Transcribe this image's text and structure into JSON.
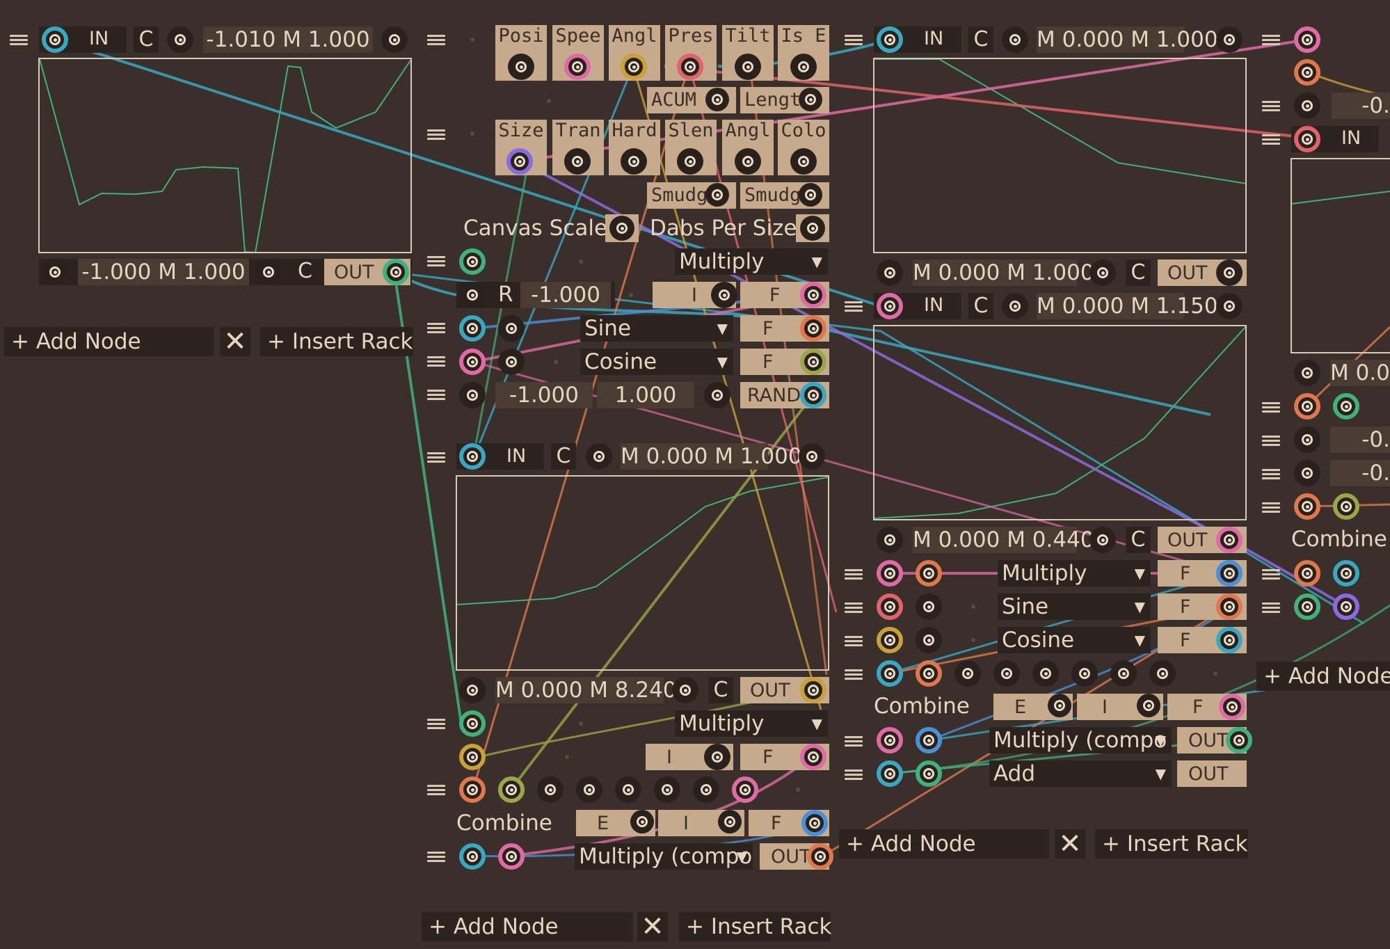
{
  "colors": {
    "background": "#3a2f2a",
    "teal": "#3aa7c2",
    "pink": "#e06aa6",
    "orange": "#e0774f",
    "green": "#41b07a",
    "olive": "#9aa64a",
    "purple": "#8a6ae0",
    "yellow": "#c9a03a",
    "red": "#e0626b",
    "blue": "#4a90d9",
    "tan": "#c7a98c"
  },
  "rack1": {
    "in_label": "IN",
    "c_label": "C",
    "in_range": "-1.010 M 1.000",
    "out_range": "-1.000 M 1.000",
    "out_c_label": "C",
    "out_label": "OUT",
    "add_node": "Add Node",
    "insert_rack": "Insert Rack"
  },
  "rack2": {
    "tabs1": [
      "Posi",
      "Spee",
      "Angl",
      "Pres",
      "Tilt",
      "Is E"
    ],
    "acum": "ACUM",
    "lengt": "Lengt",
    "tabs2": [
      "Size",
      "Tran",
      "Hard",
      "Slen",
      "Angl",
      "Colo"
    ],
    "smudg1": "Smudg",
    "smudg2": "Smudg",
    "canvas_scale": "Canvas Scale",
    "dabs_per_size": "Dabs Per Size",
    "multiply": "Multiply",
    "r_label": "R",
    "r_value": "-1.000",
    "i_label": "I",
    "f_label": "F",
    "sine": "Sine",
    "cosine": "Cosine",
    "rand_min": "-1.000",
    "rand_max": "1.000",
    "rand": "RAND",
    "in_label": "IN",
    "c_label": "C",
    "in_range": "M 0.000 M 1.000",
    "out_range": "M 0.000 M 8.240",
    "out_c_label": "C",
    "out_label": "OUT",
    "multiply2": "Multiply",
    "combine": "Combine",
    "e_label": "E",
    "multiply_compo": "Multiply (compo",
    "out2": "OUT",
    "add_node": "Add Node",
    "insert_rack": "Insert Rack"
  },
  "rack3": {
    "in_label": "IN",
    "c_label": "C",
    "in_range1": "M 0.000 M 1.000",
    "out_range1": "M 0.000 M 1.000",
    "out_label": "OUT",
    "in_range2": "M 0.000 M 1.150",
    "out_range2": "M 0.000 M 0.440",
    "multiply": "Multiply",
    "sine": "Sine",
    "cosine": "Cosine",
    "f_label": "F",
    "combine": "Combine",
    "e_label": "E",
    "i_label": "I",
    "multiply_compo": "Multiply (compo",
    "add": "Add",
    "add_node": "Add Node",
    "insert_rack": "Insert Rack"
  },
  "rack4": {
    "in_label": "IN",
    "v1": "-0.",
    "m_range": "M 0.0",
    "v2": "-0.",
    "v3": "-0.",
    "combine": "Combine",
    "add_node": "Add Node"
  }
}
